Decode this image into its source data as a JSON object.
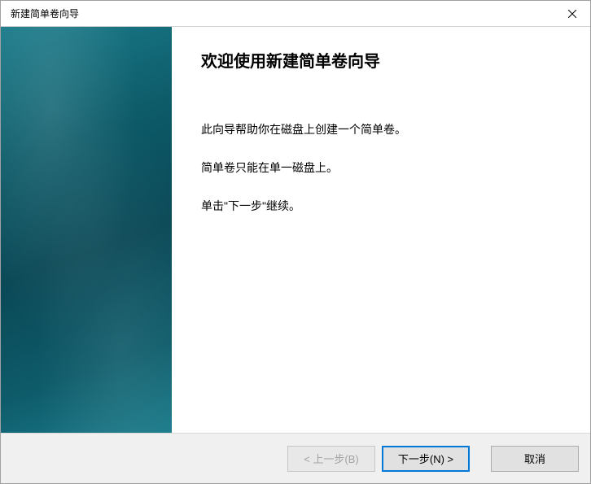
{
  "titlebar": {
    "title": "新建简单卷向导"
  },
  "main": {
    "heading": "欢迎使用新建简单卷向导",
    "line1": "此向导帮助你在磁盘上创建一个简单卷。",
    "line2": "简单卷只能在单一磁盘上。",
    "line3": "单击\"下一步\"继续。"
  },
  "buttons": {
    "back": "< 上一步(B)",
    "next": "下一步(N) >",
    "cancel": "取消"
  }
}
